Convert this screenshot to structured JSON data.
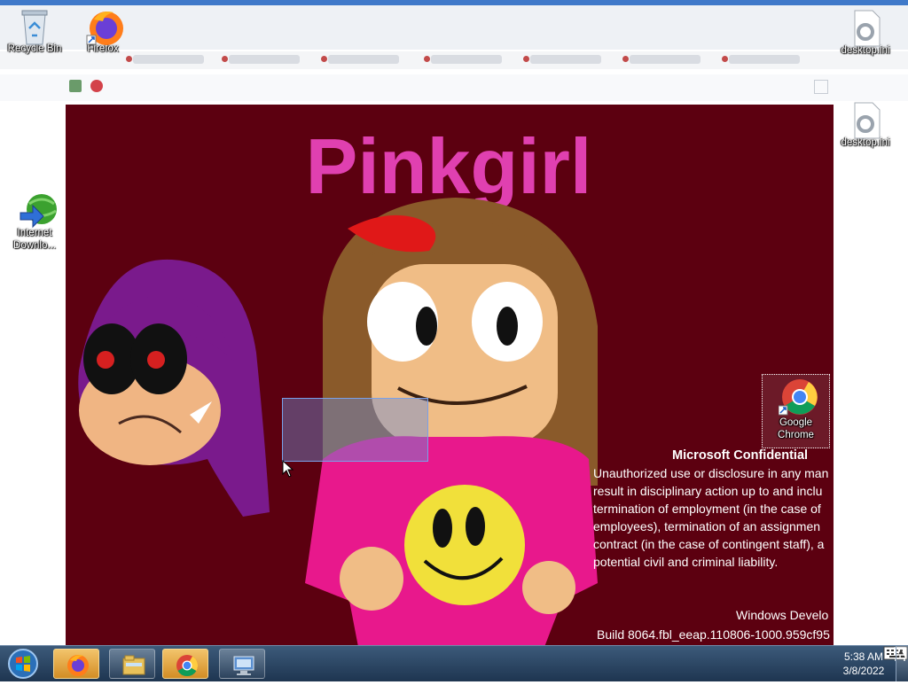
{
  "desktop": {
    "icons": [
      {
        "label": "Recycle Bin",
        "icon": "recycle-bin-icon"
      },
      {
        "label": "Firefox",
        "icon": "firefox-icon"
      },
      {
        "label": "desktop.ini",
        "icon": "settings-file-icon"
      },
      {
        "label": "desktop.ini",
        "icon": "settings-file-icon"
      },
      {
        "label": "Internet Downlo...",
        "icon": "internet-download-manager-icon"
      },
      {
        "label": "Google Chrome",
        "icon": "chrome-icon"
      }
    ]
  },
  "artwork": {
    "title": "Pinkgirl",
    "colors": {
      "background": "#5c0010",
      "title": "#e040b0",
      "shirt": "#e8188c",
      "hair": "#8a5a2a",
      "bow": "#e01818"
    }
  },
  "watermark": {
    "title": "Microsoft Confidential",
    "lines": [
      "Unauthorized use or disclosure in any man",
      "result in disciplinary action up to and inclu",
      "termination of employment (in the case of",
      "employees), termination of an assignmen",
      "contract (in the case of contingent staff), a",
      "potential civil and criminal liability."
    ],
    "edition": "Windows Develo",
    "build": "Build 8064.fbl_eeap.110806-1000.959cf95"
  },
  "taskbar": {
    "start": "start-orb-icon",
    "pinned": [
      {
        "icon": "firefox-icon",
        "active": true
      },
      {
        "icon": "file-explorer-icon",
        "active": false
      },
      {
        "icon": "chrome-icon",
        "active": true
      },
      {
        "icon": "remote-desktop-icon",
        "active": false
      }
    ],
    "tray": {
      "keyboard": "keyboard-icon",
      "overflow": "▲",
      "network": "network-icon"
    },
    "clock": {
      "time": "5:38 AM",
      "date": "3/8/2022"
    }
  }
}
